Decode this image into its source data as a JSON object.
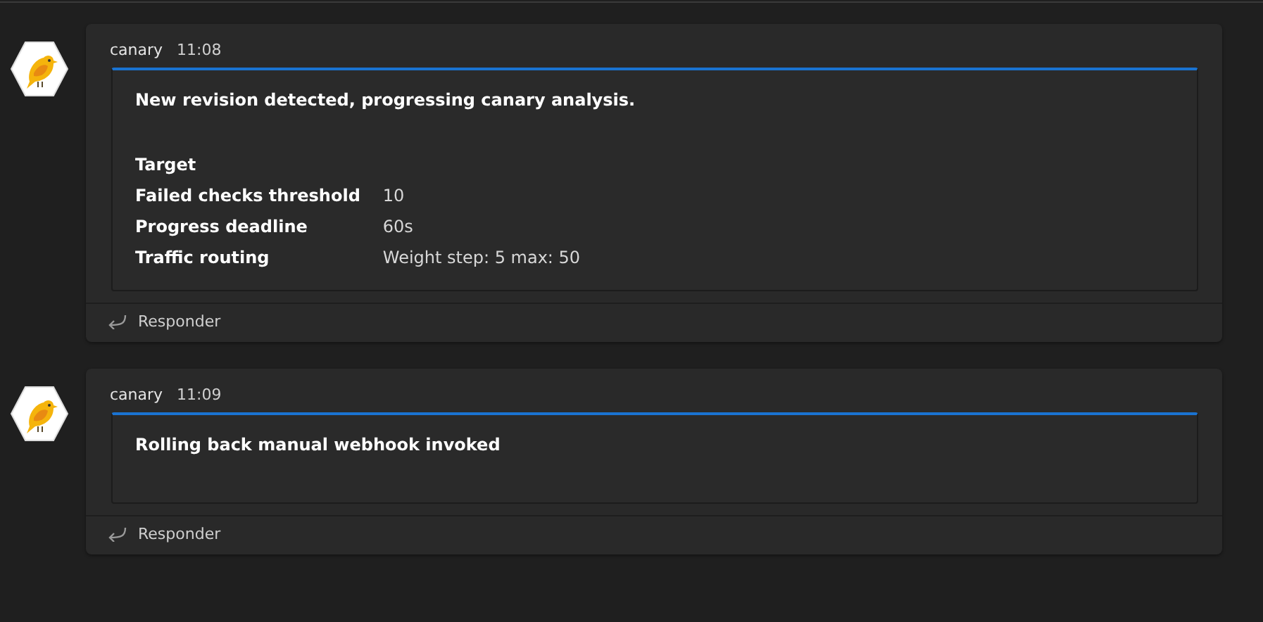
{
  "messages": [
    {
      "sender": "canary",
      "time": "11:08",
      "title": "New revision detected, progressing canary analysis.",
      "facts": [
        {
          "label": "Target"
        },
        {
          "label": "Failed checks threshold",
          "value": "10"
        },
        {
          "label": "Progress deadline",
          "value": "60s"
        },
        {
          "label": "Traffic routing",
          "value": "Weight step: 5 max: 50"
        }
      ],
      "reply": "Responder"
    },
    {
      "sender": "canary",
      "time": "11:09",
      "title": "Rolling back manual webhook invoked",
      "reply": "Responder"
    }
  ]
}
